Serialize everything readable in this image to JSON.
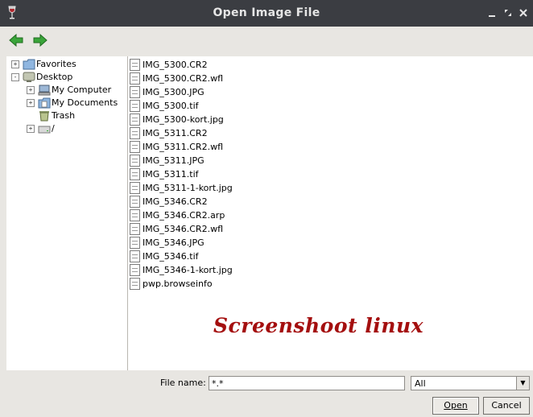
{
  "window": {
    "title": "Open Image File"
  },
  "tree": [
    {
      "label": "Favorites",
      "icon": "folder-icon",
      "expander": "+"
    },
    {
      "label": "Desktop",
      "icon": "desktop-icon",
      "expander": "-"
    },
    {
      "label": "My Computer",
      "icon": "computer-icon",
      "expander": "+"
    },
    {
      "label": "My Documents",
      "icon": "documents-icon",
      "expander": "+"
    },
    {
      "label": "Trash",
      "icon": "trash-icon",
      "expander": ""
    },
    {
      "label": "/",
      "icon": "drive-icon",
      "expander": "+"
    }
  ],
  "files": [
    "IMG_5300.CR2",
    "IMG_5300.CR2.wfl",
    "IMG_5300.JPG",
    "IMG_5300.tif",
    "IMG_5300-kort.jpg",
    "IMG_5311.CR2",
    "IMG_5311.CR2.wfl",
    "IMG_5311.JPG",
    "IMG_5311.tif",
    "IMG_5311-1-kort.jpg",
    "IMG_5346.CR2",
    "IMG_5346.CR2.arp",
    "IMG_5346.CR2.wfl",
    "IMG_5346.JPG",
    "IMG_5346.tif",
    "IMG_5346-1-kort.jpg",
    "pwp.browseinfo"
  ],
  "watermark": "Screenshoot linux",
  "bottom": {
    "file_name_label": "File name:",
    "file_name_value": "*.*",
    "file_type_value": "All",
    "open_label": "Open",
    "cancel_label": "Cancel"
  },
  "colors": {
    "titlebar": "#3b3d42",
    "watermark": "#a40f0f",
    "nav_arrow": "#3aa53a"
  }
}
